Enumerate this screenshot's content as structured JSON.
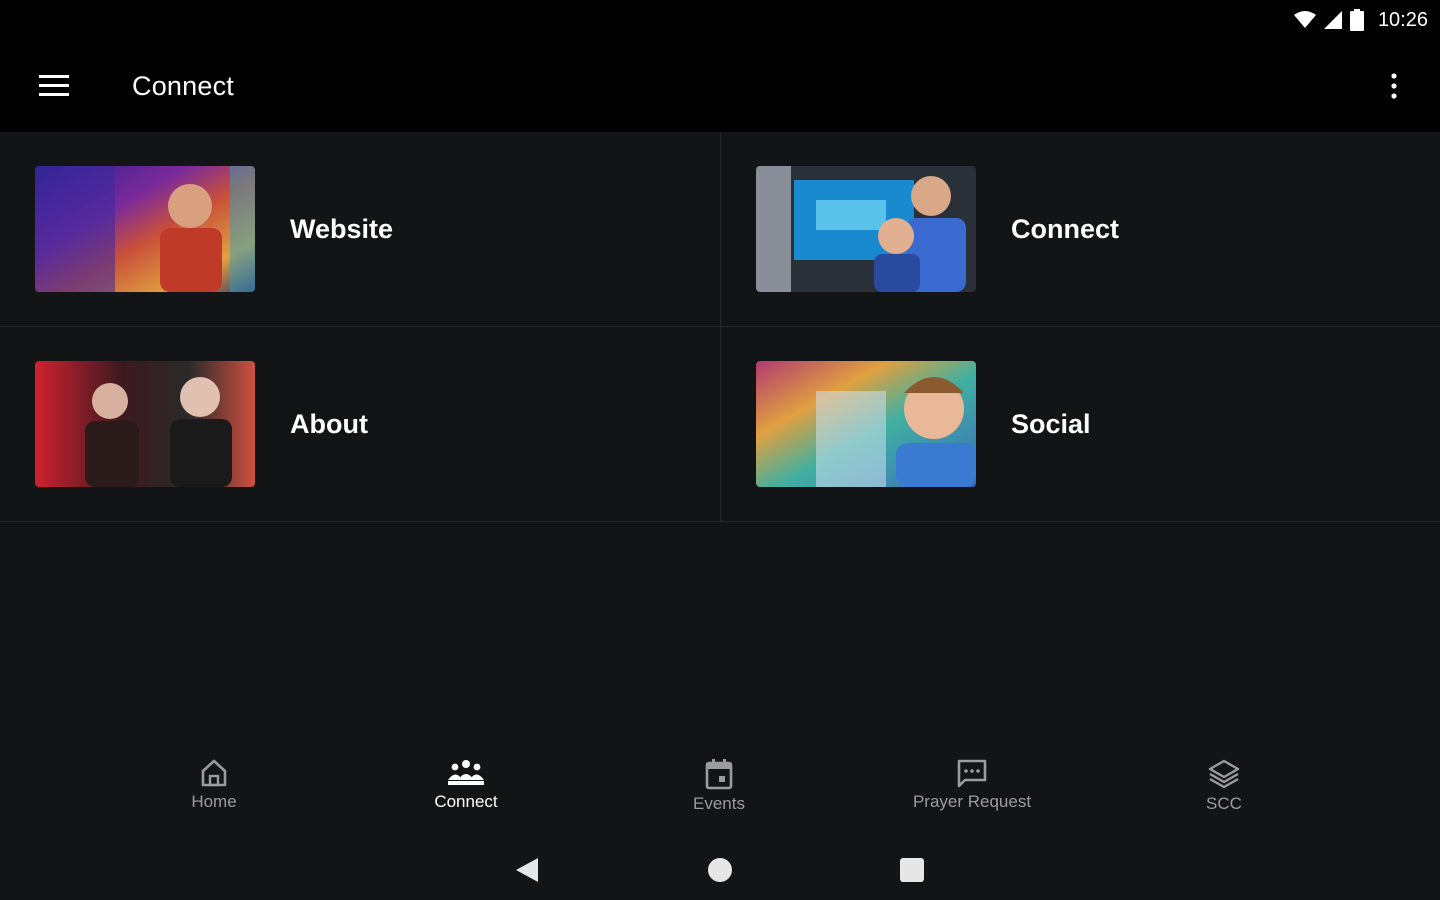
{
  "status": {
    "time": "10:26"
  },
  "app_bar": {
    "title": "Connect"
  },
  "tiles": [
    {
      "label": "Website"
    },
    {
      "label": "Connect"
    },
    {
      "label": "About"
    },
    {
      "label": "Social"
    }
  ],
  "bottom_nav": {
    "items": [
      {
        "label": "Home",
        "icon": "home-icon",
        "active": false
      },
      {
        "label": "Connect",
        "icon": "people-group-icon",
        "active": true
      },
      {
        "label": "Events",
        "icon": "calendar-icon",
        "active": false
      },
      {
        "label": "Prayer Request",
        "icon": "chat-bubble-icon",
        "active": false
      },
      {
        "label": "SCC",
        "icon": "layers-icon",
        "active": false
      }
    ]
  },
  "colors": {
    "background": "#131416",
    "bar": "#000000",
    "inactive_label": "#9a9ca0",
    "active_label": "#ffffff"
  }
}
